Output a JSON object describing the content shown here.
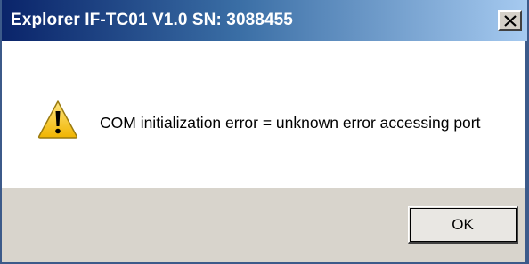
{
  "window": {
    "title": "Explorer  IF-TC01 V1.0  SN: 3088455",
    "close_icon": "close-x-icon"
  },
  "content": {
    "icon": "warning-icon",
    "message": "COM initialization error = unknown error accessing port"
  },
  "footer": {
    "ok_label": "OK"
  },
  "colors": {
    "titlebar_start": "#0a246a",
    "titlebar_end": "#a6caf0",
    "warning_fill": "#f5c400",
    "footer_bg": "#d8d4cc"
  }
}
